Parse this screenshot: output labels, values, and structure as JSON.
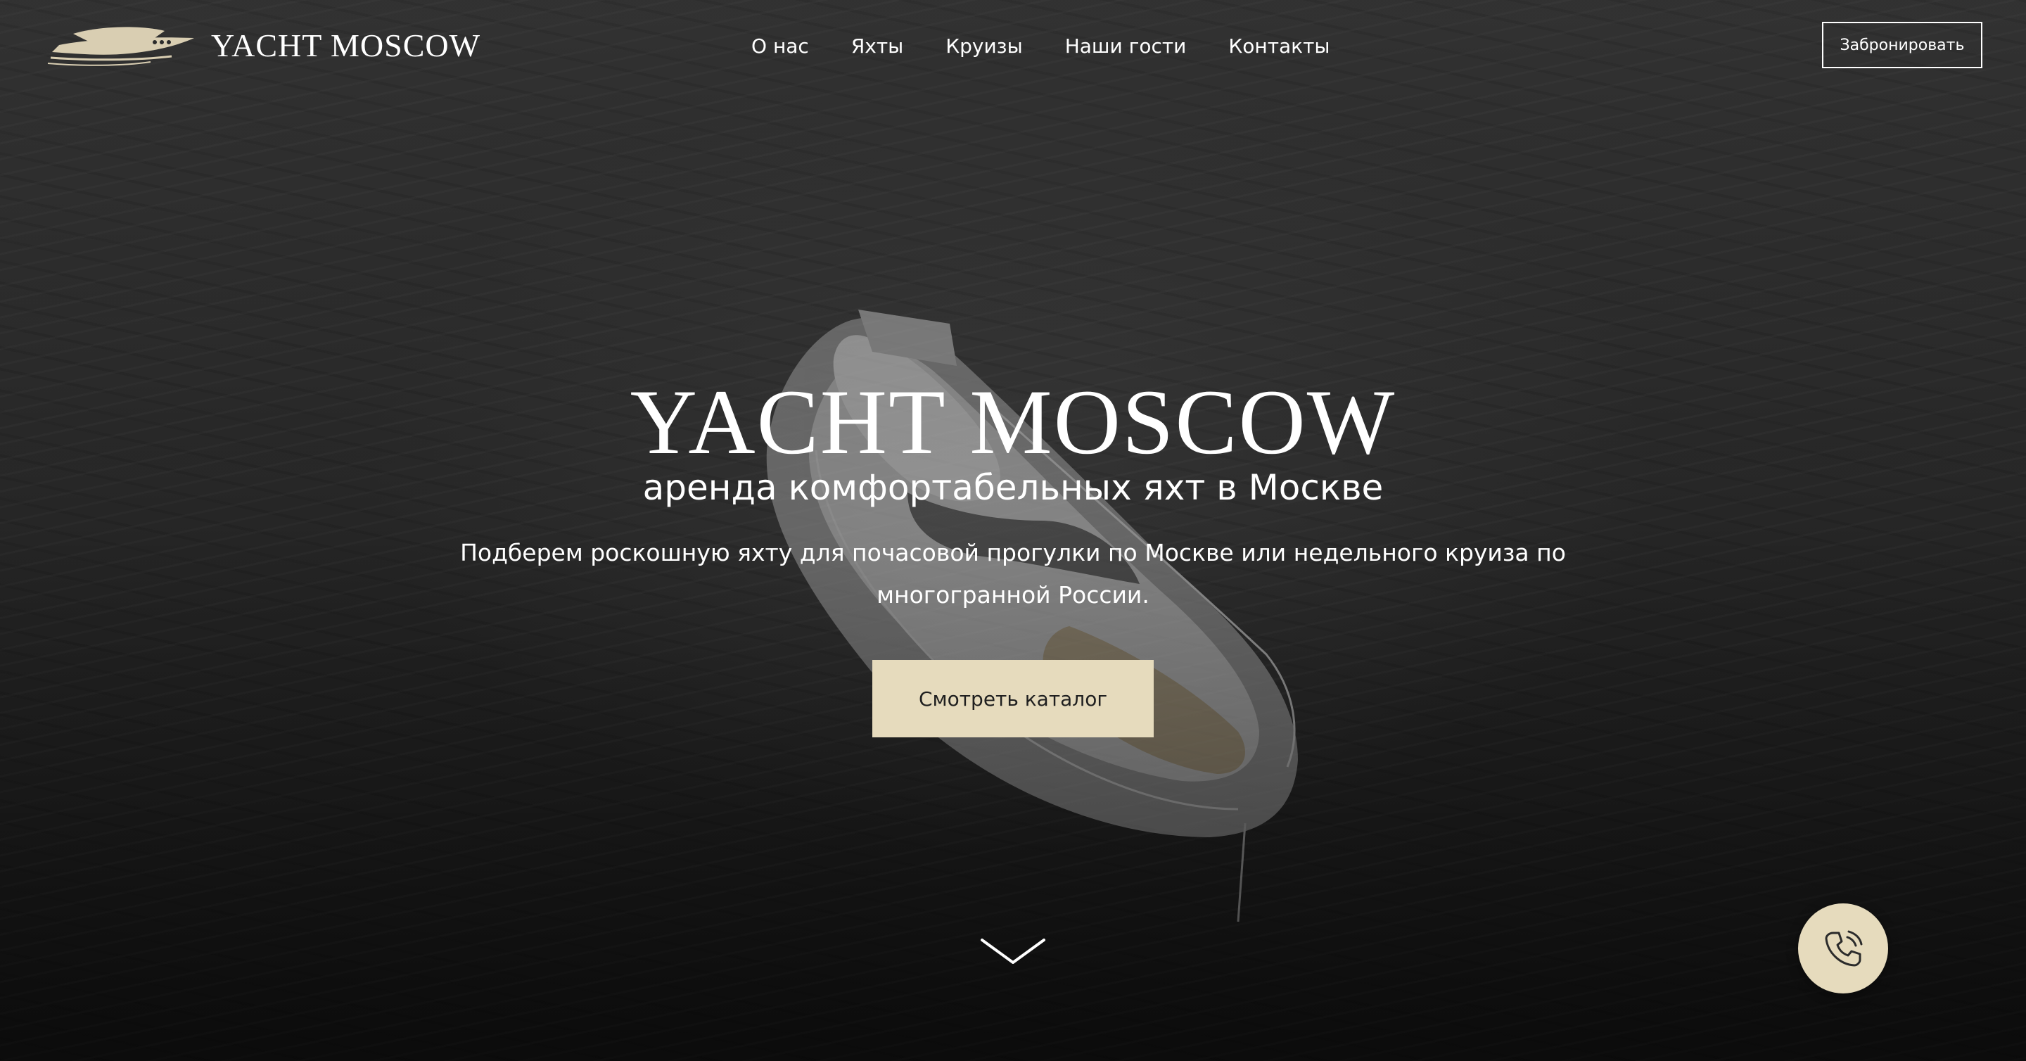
{
  "header": {
    "logo_text": "YACHT MOSCOW",
    "nav": [
      {
        "label": "О нас"
      },
      {
        "label": "Яхты"
      },
      {
        "label": "Круизы"
      },
      {
        "label": "Наши гости"
      },
      {
        "label": "Контакты"
      }
    ],
    "book_button": "Забронировать"
  },
  "hero": {
    "title": "YACHT MOSCOW",
    "subtitle": "аренда комфортабельных яхт в Москве",
    "description": "Подберем роскошную яхту для почасовой прогулки по Москве или недельного круиза по многогранной России.",
    "catalog_button": "Смотреть каталог"
  },
  "icons": {
    "logo": "yacht-logo-icon",
    "scroll": "chevron-down-icon",
    "call": "phone-icon"
  },
  "colors": {
    "accent": "#e6dbbd",
    "text": "#ffffff",
    "background": "#2b2b2b"
  }
}
